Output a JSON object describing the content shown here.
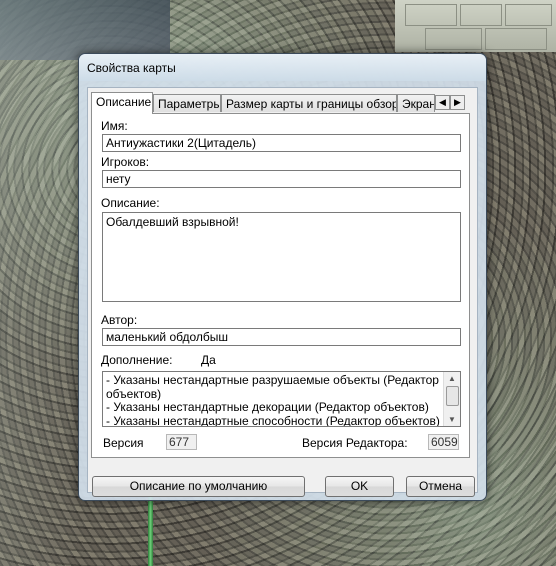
{
  "window": {
    "title": "Свойства карты"
  },
  "tabs": [
    {
      "label": "Описание",
      "active": true
    },
    {
      "label": "Параметры",
      "active": false
    },
    {
      "label": "Размер карты и границы обзора",
      "active": false
    },
    {
      "label": "Экран",
      "active": false
    }
  ],
  "form": {
    "name_label": "Имя:",
    "name_value": "Антиужастики 2(Цитадель)",
    "players_label": "Игроков:",
    "players_value": "нету",
    "description_label": "Описание:",
    "description_value": "Обалдевший взрывной!",
    "author_label": "Автор:",
    "author_value": "маленький обдолбыш",
    "addon_label": "Дополнение:",
    "addon_value": "Да",
    "addon_list": [
      "- Указаны нестандартные разрушаемые объекты (Редактор",
      "объектов)",
      "- Указаны нестандартные декорации (Редактор объектов)",
      "- Указаны нестандартные способности (Редактор объектов)"
    ],
    "version_label": "Версия",
    "version_value": "677",
    "editor_version_label": "Версия Редактора:",
    "editor_version_value": "6059"
  },
  "buttons": {
    "default_description": "Описание по умолчанию",
    "ok": "OK",
    "cancel": "Отмена"
  }
}
